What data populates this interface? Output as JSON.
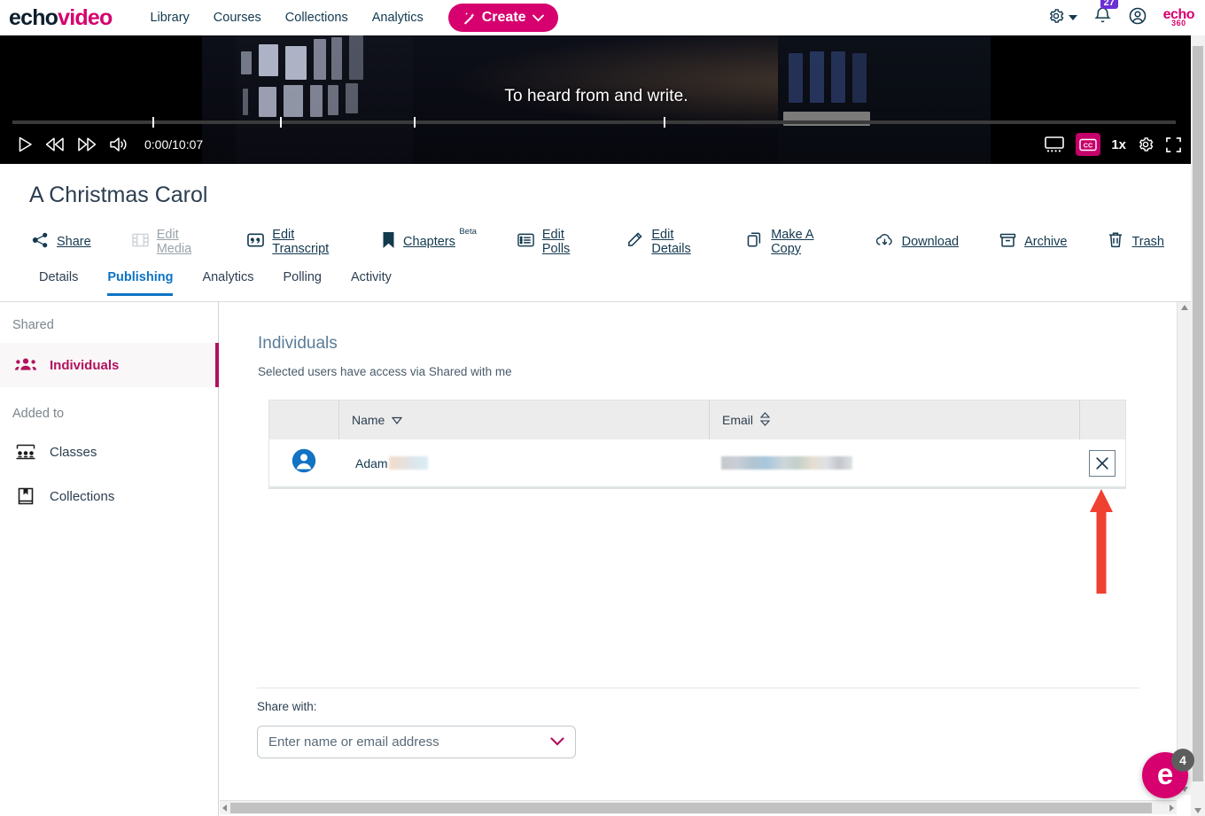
{
  "topnav": {
    "brand_first": "echo",
    "brand_second": "video",
    "links": [
      {
        "label": "Library"
      },
      {
        "label": "Courses"
      },
      {
        "label": "Collections"
      },
      {
        "label": "Analytics"
      }
    ],
    "create_label": "Create",
    "notification_count": "27",
    "logo_top": "echo",
    "logo_bottom": "360",
    "icons": {
      "settings": "gear-icon",
      "notifications": "bell-icon",
      "account": "account-circle-icon",
      "create": "magic-wand-icon"
    }
  },
  "player": {
    "caption": "To heard from and write.",
    "time": "0:00/10:07",
    "speed": "1x",
    "cc_label": "CC",
    "cc_active": true,
    "accent": "#c6006a"
  },
  "media": {
    "title": "A Christmas Carol",
    "actions": [
      {
        "label": "Share",
        "icon": "share-nodes-icon",
        "disabled": false
      },
      {
        "label": "Edit Media",
        "icon": "film-strip-icon",
        "disabled": true
      },
      {
        "label": "Edit Transcript",
        "icon": "quote-icon",
        "disabled": false
      },
      {
        "label": "Chapters",
        "icon": "bookmark-icon",
        "disabled": false,
        "superscript": "Beta"
      },
      {
        "label": "Edit Polls",
        "icon": "list-icon",
        "disabled": false
      },
      {
        "label": "Edit Details",
        "icon": "pencil-icon",
        "disabled": false
      },
      {
        "label": "Make A Copy",
        "icon": "copy-icon",
        "disabled": false
      },
      {
        "label": "Download",
        "icon": "cloud-download-icon",
        "disabled": false
      },
      {
        "label": "Archive",
        "icon": "archive-box-icon",
        "disabled": false
      },
      {
        "label": "Trash",
        "icon": "trash-icon",
        "disabled": false
      }
    ],
    "tabs": [
      {
        "label": "Details",
        "active": false
      },
      {
        "label": "Publishing",
        "active": true
      },
      {
        "label": "Analytics",
        "active": false
      },
      {
        "label": "Polling",
        "active": false
      },
      {
        "label": "Activity",
        "active": false
      }
    ],
    "active_tab_color": "#0b74c4"
  },
  "sidebar": {
    "sections": [
      {
        "header": "Shared",
        "items": [
          {
            "label": "Individuals",
            "icon": "people-group-icon",
            "active": true
          }
        ]
      },
      {
        "header": "Added to",
        "items": [
          {
            "label": "Classes",
            "icon": "classroom-icon",
            "active": false
          },
          {
            "label": "Collections",
            "icon": "book-bookmark-icon",
            "active": false
          }
        ]
      }
    ],
    "active_color": "#b2125e"
  },
  "main": {
    "heading": "Individuals",
    "subheading": "Selected users have access via Shared with me",
    "table": {
      "columns": [
        {
          "label": "",
          "sort": "none"
        },
        {
          "label": "Name",
          "sort": "desc"
        },
        {
          "label": "Email",
          "sort": "none"
        },
        {
          "label": "",
          "sort": "none"
        }
      ],
      "rows": [
        {
          "avatar": "user-avatar-icon",
          "name": "Adam",
          "name_redacted": true,
          "email": "",
          "email_redacted": true,
          "remove_label": "✕"
        }
      ]
    },
    "share_with_label": "Share with:",
    "share_with_placeholder": "Enter name or email address"
  },
  "annotation": {
    "arrow": "red-up-arrow",
    "color": "#f04030"
  },
  "chat": {
    "avatar_letter": "e",
    "badge_count": "4"
  }
}
